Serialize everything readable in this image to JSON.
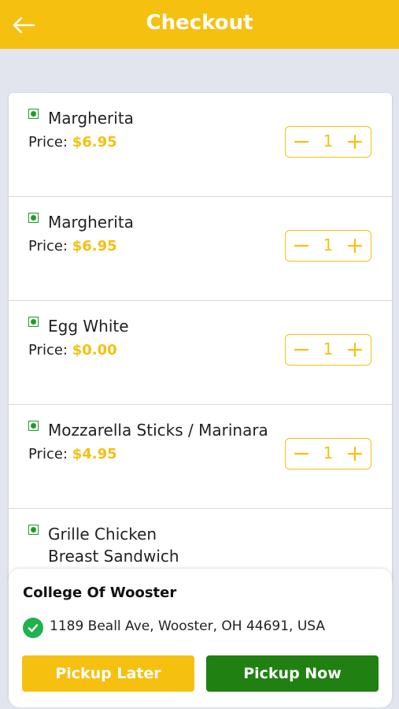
{
  "header": {
    "title": "Checkout",
    "back_icon": "arrow-left-icon"
  },
  "items": [
    {
      "name": "Margherita",
      "price_label": "Price:",
      "price": "$6.95",
      "qty": "1"
    },
    {
      "name": "Margherita",
      "price_label": "Price:",
      "price": "$6.95",
      "qty": "1"
    },
    {
      "name": "Egg White",
      "price_label": "Price:",
      "price": "$0.00",
      "qty": "1"
    },
    {
      "name": "Mozzarella Sticks / Marinara",
      "price_label": "Price:",
      "price": "$4.95",
      "qty": "1"
    },
    {
      "name": "Grille Chicken Breast Sandwich"
    }
  ],
  "pickup": {
    "location_name": "College Of Wooster",
    "address": "1189 Beall Ave, Wooster, OH 44691, USA",
    "later_label": "Pickup Later",
    "now_label": "Pickup Now"
  },
  "colors": {
    "accent": "#f5c010",
    "primary_green": "#218012",
    "veg_green": "#1f9a2c",
    "background": "#e3e5ee"
  }
}
